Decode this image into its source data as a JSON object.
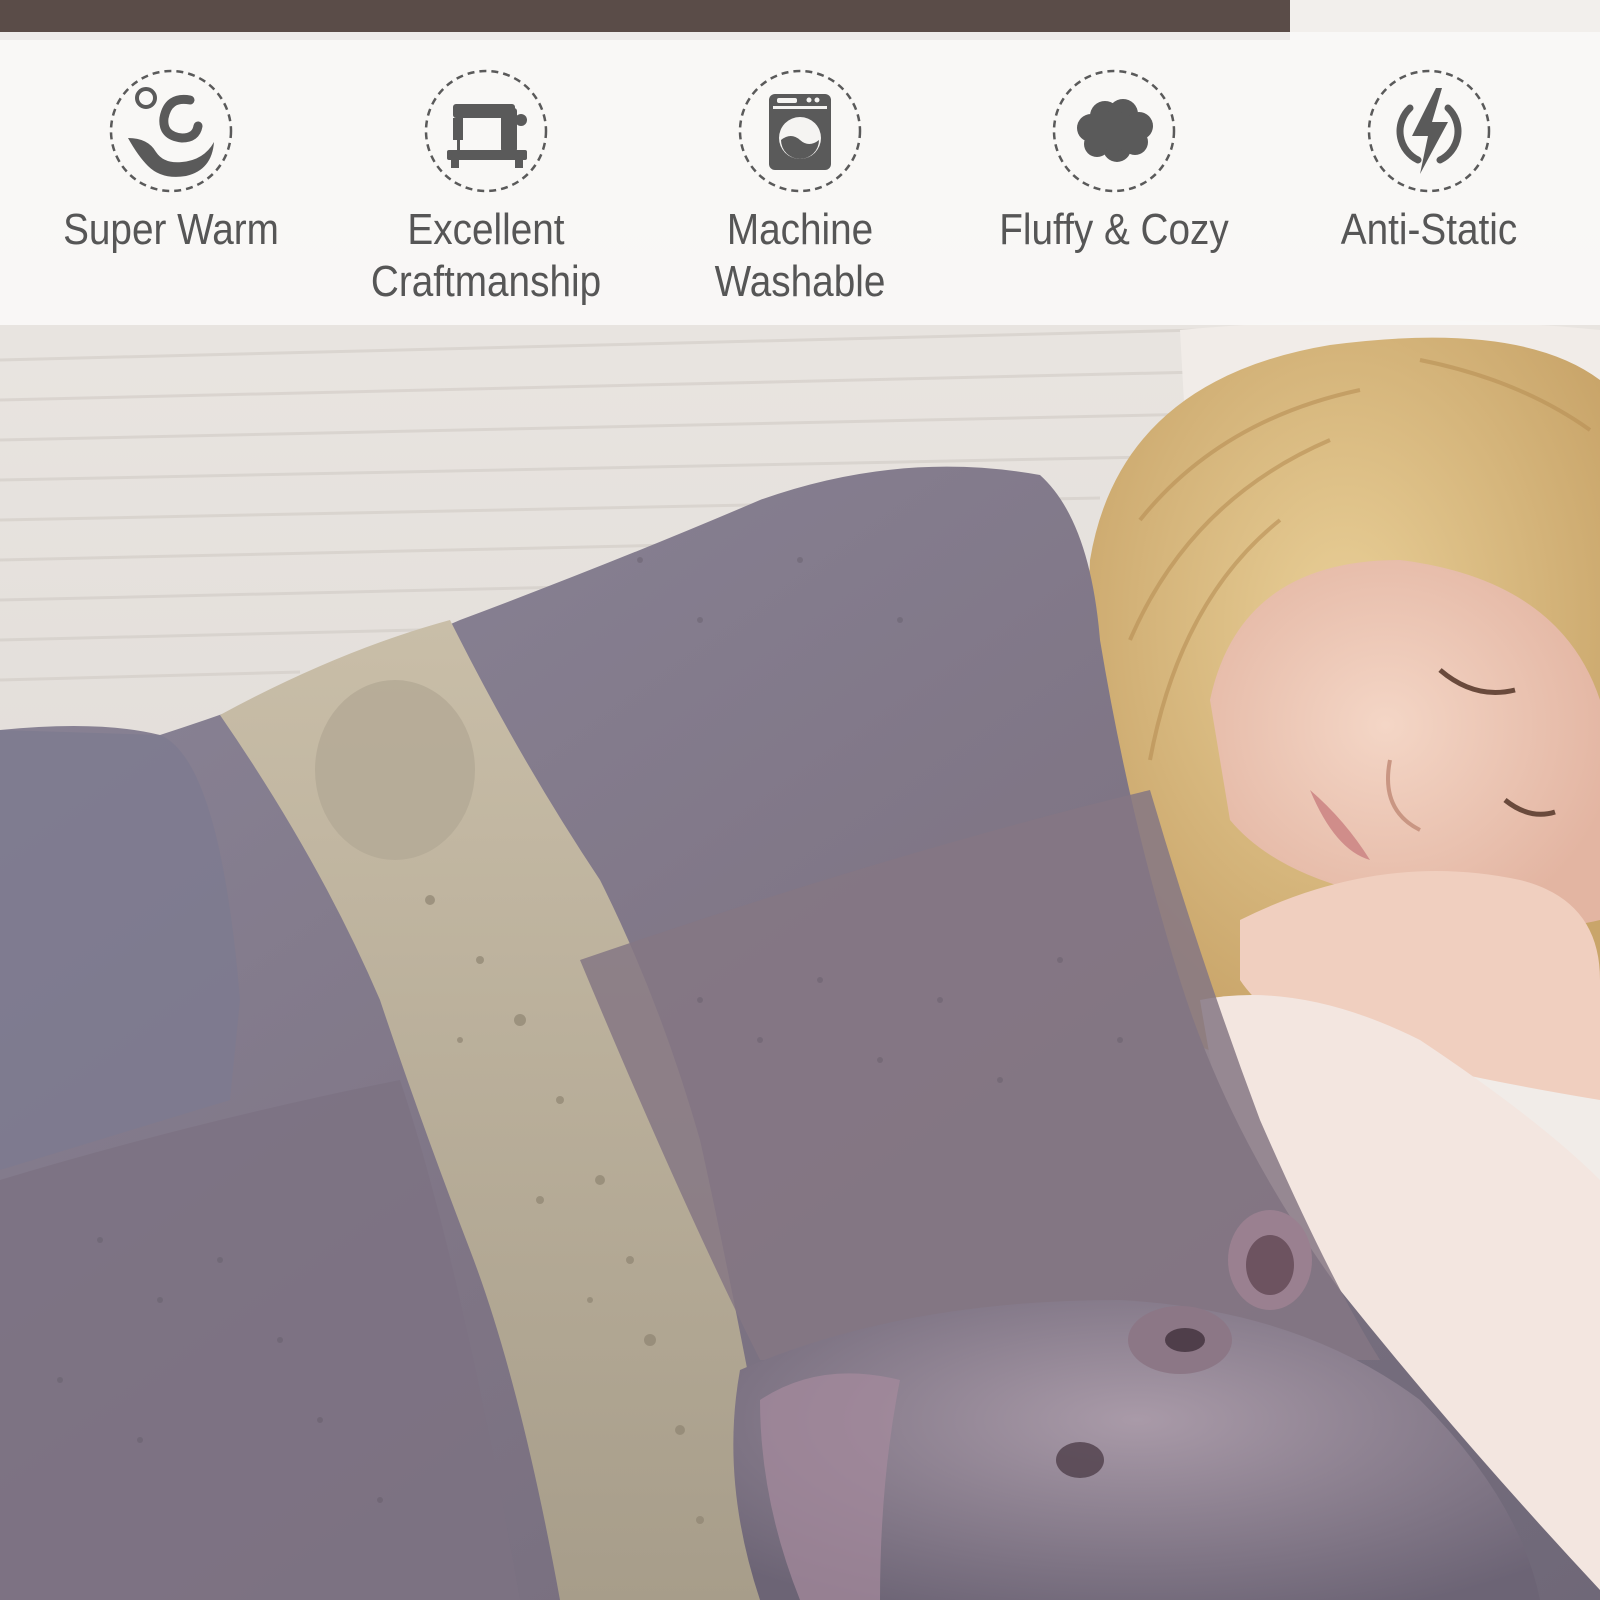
{
  "features": [
    {
      "icon": "warm-swirl-icon",
      "label": "Super Warm"
    },
    {
      "icon": "sewing-machine-icon",
      "label": "Excellent\nCraftmanship"
    },
    {
      "icon": "washing-machine-icon",
      "label": "Machine\nWashable"
    },
    {
      "icon": "fluffy-cloud-icon",
      "label": "Fluffy & Cozy"
    },
    {
      "icon": "lightning-bolt-icon",
      "label": "Anti-Static"
    }
  ],
  "colors": {
    "icon_gray": "#5a5a5a",
    "label_gray": "#565656",
    "banner_bg": "#faf9f7"
  }
}
